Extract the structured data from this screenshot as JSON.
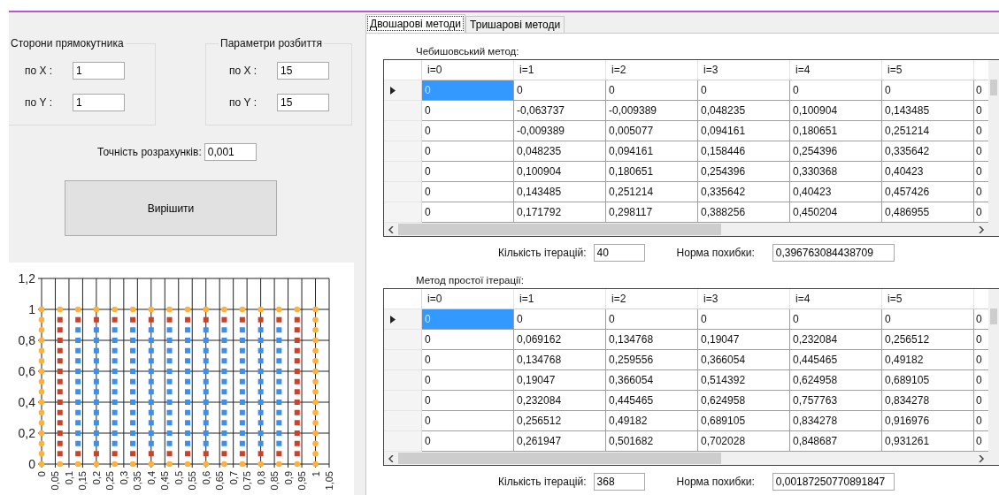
{
  "left_panel": {
    "groups": [
      {
        "title": "Сторони прямокутника",
        "fields": [
          {
            "label": "по X :",
            "value": "1"
          },
          {
            "label": "по Y :",
            "value": "1"
          }
        ]
      },
      {
        "title": "Параметри розбиття",
        "fields": [
          {
            "label": "по X :",
            "value": "15"
          },
          {
            "label": "по Y :",
            "value": "15"
          }
        ]
      }
    ],
    "precision": {
      "label": "Точність розрахунків:",
      "value": "0,001"
    },
    "solve_button": "Вирішити"
  },
  "chart": {
    "chart_data": {
      "type": "scatter",
      "xlim": [
        0,
        1.05
      ],
      "ylim": [
        0,
        1.2
      ],
      "grid": true,
      "xticks": [
        {
          "value": 0,
          "label": "0"
        },
        {
          "value": 0.05,
          "label": "0,05"
        },
        {
          "value": 0.1,
          "label": "0,1"
        },
        {
          "value": 0.15,
          "label": "0,15"
        },
        {
          "value": 0.2,
          "label": "0,2"
        },
        {
          "value": 0.25,
          "label": "0,25"
        },
        {
          "value": 0.3,
          "label": "0,3"
        },
        {
          "value": 0.35,
          "label": "0,35"
        },
        {
          "value": 0.4,
          "label": "0,4"
        },
        {
          "value": 0.45,
          "label": "0,45"
        },
        {
          "value": 0.5,
          "label": "0,5"
        },
        {
          "value": 0.55,
          "label": "0,55"
        },
        {
          "value": 0.6,
          "label": "0,6"
        },
        {
          "value": 0.65,
          "label": "0,65"
        },
        {
          "value": 0.7,
          "label": "0,7"
        },
        {
          "value": 0.75,
          "label": "0,75"
        },
        {
          "value": 0.8,
          "label": "0,8"
        },
        {
          "value": 0.85,
          "label": "0,85"
        },
        {
          "value": 0.9,
          "label": "0,9"
        },
        {
          "value": 0.95,
          "label": "0,95"
        },
        {
          "value": 1,
          "label": "1"
        },
        {
          "value": 1.05,
          "label": "1,05"
        }
      ],
      "yticks": [
        {
          "value": 0,
          "label": "0"
        },
        {
          "value": 0.2,
          "label": "0,2"
        },
        {
          "value": 0.4,
          "label": "0,4"
        },
        {
          "value": 0.6,
          "label": "0,6"
        },
        {
          "value": 0.8,
          "label": "0,8"
        },
        {
          "value": 1,
          "label": "1"
        },
        {
          "value": 1.2,
          "label": "1,2"
        }
      ],
      "series": [
        {
          "color": "#ffb13b",
          "marker": "circle",
          "x": [
            0,
            0,
            0,
            0,
            0,
            0,
            0,
            0,
            0,
            0,
            0,
            0,
            0,
            0,
            0,
            0,
            0.067,
            0.067,
            0.133,
            0.133,
            0.2,
            0.2,
            0.267,
            0.267,
            0.333,
            0.333,
            0.4,
            0.4,
            0.467,
            0.467,
            0.533,
            0.533,
            0.6,
            0.6,
            0.667,
            0.667,
            0.733,
            0.733,
            0.8,
            0.8,
            0.867,
            0.867,
            0.933,
            0.933,
            1,
            1,
            1,
            1,
            1,
            1,
            1,
            1,
            1,
            1,
            1,
            1,
            1,
            1,
            1,
            1
          ],
          "values": [
            0,
            0.067,
            0.133,
            0.2,
            0.267,
            0.333,
            0.4,
            0.467,
            0.533,
            0.6,
            0.667,
            0.733,
            0.8,
            0.867,
            0.933,
            1,
            0,
            1,
            0,
            1,
            0,
            1,
            0,
            1,
            0,
            1,
            0,
            1,
            0,
            1,
            0,
            1,
            0,
            1,
            0,
            1,
            0,
            1,
            0,
            1,
            0,
            1,
            0,
            1,
            0,
            0.067,
            0.133,
            0.2,
            0.267,
            0.333,
            0.4,
            0.467,
            0.533,
            0.6,
            0.667,
            0.733,
            0.8,
            0.867,
            0.933,
            1
          ]
        },
        {
          "color": "#c9432b",
          "marker": "square",
          "x": [
            0.067,
            0.067,
            0.067,
            0.067,
            0.067,
            0.067,
            0.067,
            0.067,
            0.067,
            0.067,
            0.067,
            0.067,
            0.067,
            0.067,
            0.133,
            0.133,
            0.2,
            0.2,
            0.267,
            0.267,
            0.333,
            0.333,
            0.4,
            0.4,
            0.467,
            0.467,
            0.533,
            0.533,
            0.6,
            0.6,
            0.667,
            0.667,
            0.733,
            0.733,
            0.8,
            0.8,
            0.867,
            0.867,
            0.933,
            0.933,
            0.933,
            0.933,
            0.933,
            0.933,
            0.933,
            0.933,
            0.933,
            0.933,
            0.933,
            0.933,
            0.933,
            0.933
          ],
          "values": [
            0.067,
            0.133,
            0.2,
            0.267,
            0.333,
            0.4,
            0.467,
            0.533,
            0.6,
            0.667,
            0.733,
            0.8,
            0.867,
            0.933,
            0.067,
            0.933,
            0.067,
            0.933,
            0.067,
            0.933,
            0.067,
            0.933,
            0.067,
            0.933,
            0.067,
            0.933,
            0.067,
            0.933,
            0.067,
            0.933,
            0.067,
            0.933,
            0.067,
            0.933,
            0.067,
            0.933,
            0.067,
            0.933,
            0.067,
            0.133,
            0.2,
            0.267,
            0.333,
            0.4,
            0.467,
            0.533,
            0.6,
            0.667,
            0.733,
            0.8,
            0.867,
            0.933
          ]
        },
        {
          "color": "#3d8fe8",
          "marker": "square",
          "x": [
            0.133,
            0.133,
            0.133,
            0.133,
            0.133,
            0.133,
            0.133,
            0.133,
            0.133,
            0.133,
            0.133,
            0.133,
            0.2,
            0.2,
            0.2,
            0.2,
            0.2,
            0.2,
            0.2,
            0.2,
            0.2,
            0.2,
            0.2,
            0.2,
            0.267,
            0.267,
            0.267,
            0.267,
            0.267,
            0.267,
            0.267,
            0.267,
            0.267,
            0.267,
            0.267,
            0.267,
            0.333,
            0.333,
            0.333,
            0.333,
            0.333,
            0.333,
            0.333,
            0.333,
            0.333,
            0.333,
            0.333,
            0.333,
            0.4,
            0.4,
            0.4,
            0.4,
            0.4,
            0.4,
            0.4,
            0.4,
            0.4,
            0.4,
            0.4,
            0.4,
            0.467,
            0.467,
            0.467,
            0.467,
            0.467,
            0.467,
            0.467,
            0.467,
            0.467,
            0.467,
            0.467,
            0.467,
            0.533,
            0.533,
            0.533,
            0.533,
            0.533,
            0.533,
            0.533,
            0.533,
            0.533,
            0.533,
            0.533,
            0.533,
            0.6,
            0.6,
            0.6,
            0.6,
            0.6,
            0.6,
            0.6,
            0.6,
            0.6,
            0.6,
            0.6,
            0.6,
            0.667,
            0.667,
            0.667,
            0.667,
            0.667,
            0.667,
            0.667,
            0.667,
            0.667,
            0.667,
            0.667,
            0.667,
            0.733,
            0.733,
            0.733,
            0.733,
            0.733,
            0.733,
            0.733,
            0.733,
            0.733,
            0.733,
            0.733,
            0.733,
            0.8,
            0.8,
            0.8,
            0.8,
            0.8,
            0.8,
            0.8,
            0.8,
            0.8,
            0.8,
            0.8,
            0.8,
            0.867,
            0.867,
            0.867,
            0.867,
            0.867,
            0.867,
            0.867,
            0.867,
            0.867,
            0.867,
            0.867,
            0.867
          ],
          "values": [
            0.133,
            0.2,
            0.267,
            0.333,
            0.4,
            0.467,
            0.533,
            0.6,
            0.667,
            0.733,
            0.8,
            0.867,
            0.133,
            0.2,
            0.267,
            0.333,
            0.4,
            0.467,
            0.533,
            0.6,
            0.667,
            0.733,
            0.8,
            0.867,
            0.133,
            0.2,
            0.267,
            0.333,
            0.4,
            0.467,
            0.533,
            0.6,
            0.667,
            0.733,
            0.8,
            0.867,
            0.133,
            0.2,
            0.267,
            0.333,
            0.4,
            0.467,
            0.533,
            0.6,
            0.667,
            0.733,
            0.8,
            0.867,
            0.133,
            0.2,
            0.267,
            0.333,
            0.4,
            0.467,
            0.533,
            0.6,
            0.667,
            0.733,
            0.8,
            0.867,
            0.133,
            0.2,
            0.267,
            0.333,
            0.4,
            0.467,
            0.533,
            0.6,
            0.667,
            0.733,
            0.8,
            0.867,
            0.133,
            0.2,
            0.267,
            0.333,
            0.4,
            0.467,
            0.533,
            0.6,
            0.667,
            0.733,
            0.8,
            0.867,
            0.133,
            0.2,
            0.267,
            0.333,
            0.4,
            0.467,
            0.533,
            0.6,
            0.667,
            0.733,
            0.8,
            0.867,
            0.133,
            0.2,
            0.267,
            0.333,
            0.4,
            0.467,
            0.533,
            0.6,
            0.667,
            0.733,
            0.8,
            0.867,
            0.133,
            0.2,
            0.267,
            0.333,
            0.4,
            0.467,
            0.533,
            0.6,
            0.667,
            0.733,
            0.8,
            0.867,
            0.133,
            0.2,
            0.267,
            0.333,
            0.4,
            0.467,
            0.533,
            0.6,
            0.667,
            0.733,
            0.8,
            0.867,
            0.133,
            0.2,
            0.267,
            0.333,
            0.4,
            0.467,
            0.533,
            0.6,
            0.667,
            0.733,
            0.8,
            0.867
          ]
        }
      ]
    }
  },
  "tabs": [
    {
      "label": "Двошарові методи",
      "selected": true
    },
    {
      "label": "Тришарові методи",
      "selected": false
    }
  ],
  "grids": [
    {
      "title": "Чебишовський метод:",
      "columns": [
        "i=0",
        "i=1",
        "i=2",
        "i=3",
        "i=4",
        "i=5"
      ],
      "rows": [
        {
          "selected": true,
          "cells": [
            "0",
            "0",
            "0",
            "0",
            "0",
            "0",
            "0"
          ]
        },
        {
          "selected": false,
          "cells": [
            "0",
            "-0,063737",
            "-0,009389",
            "0,048235",
            "0,100904",
            "0,143485",
            "0"
          ]
        },
        {
          "selected": false,
          "cells": [
            "0",
            "-0,009389",
            "0,005077",
            "0,094161",
            "0,180651",
            "0,251214",
            "0"
          ]
        },
        {
          "selected": false,
          "cells": [
            "0",
            "0,048235",
            "0,094161",
            "0,158446",
            "0,254396",
            "0,335642",
            "0"
          ]
        },
        {
          "selected": false,
          "cells": [
            "0",
            "0,100904",
            "0,180651",
            "0,254396",
            "0,330368",
            "0,40423",
            "0"
          ]
        },
        {
          "selected": false,
          "cells": [
            "0",
            "0,143485",
            "0,251214",
            "0,335642",
            "0,40423",
            "0,457426",
            "0"
          ]
        },
        {
          "selected": false,
          "cells": [
            "0",
            "0,171792",
            "0,298117",
            "0,388256",
            "0,450204",
            "0,486955",
            "0"
          ]
        }
      ],
      "iterations": {
        "label": "Кількість ітерацій:",
        "value": "40"
      },
      "error_norm": {
        "label": "Норма похибки:",
        "value": "0,396763084438709"
      }
    },
    {
      "title": "Метод простої ітерації:",
      "columns": [
        "i=0",
        "i=1",
        "i=2",
        "i=3",
        "i=4",
        "i=5"
      ],
      "rows": [
        {
          "selected": true,
          "cells": [
            "0",
            "0",
            "0",
            "0",
            "0",
            "0",
            "0"
          ]
        },
        {
          "selected": false,
          "cells": [
            "0",
            "0,069162",
            "0,134768",
            "0,19047",
            "0,232084",
            "0,256512",
            "0"
          ]
        },
        {
          "selected": false,
          "cells": [
            "0",
            "0,134768",
            "0,259556",
            "0,366054",
            "0,445465",
            "0,49182",
            "0"
          ]
        },
        {
          "selected": false,
          "cells": [
            "0",
            "0,19047",
            "0,366054",
            "0,514392",
            "0,624958",
            "0,689105",
            "0"
          ]
        },
        {
          "selected": false,
          "cells": [
            "0",
            "0,232084",
            "0,445465",
            "0,624958",
            "0,757763",
            "0,834278",
            "0"
          ]
        },
        {
          "selected": false,
          "cells": [
            "0",
            "0,256512",
            "0,49182",
            "0,689105",
            "0,834278",
            "0,916976",
            "0"
          ]
        },
        {
          "selected": false,
          "cells": [
            "0",
            "0,261947",
            "0,501682",
            "0,702028",
            "0,848687",
            "0,931261",
            "0"
          ]
        }
      ],
      "iterations": {
        "label": "Кількість ітерацій:",
        "value": "368"
      },
      "error_norm": {
        "label": "Норма похибки:",
        "value": "0,00187250770891847"
      }
    }
  ]
}
